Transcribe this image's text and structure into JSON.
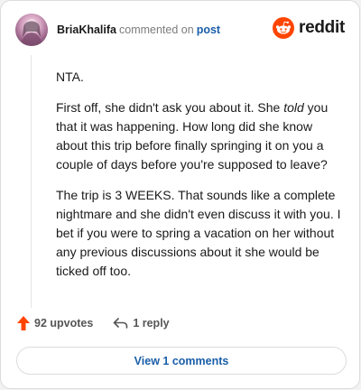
{
  "header": {
    "username": "BriaKhalifa",
    "verb": "commented on",
    "target": "post",
    "avatar_icon": "user-avatar"
  },
  "brand": {
    "name": "reddit",
    "icon": "reddit-snoo-icon",
    "color": "#ff4500"
  },
  "comment": {
    "paragraphs": [
      {
        "text": "NTA."
      },
      {
        "before": "First off, she didn't ask you about it. She ",
        "emphasis": "told",
        "after": " you that it was happening. How long did she know about this trip before finally springing it on you a couple of days before you're supposed to leave?"
      },
      {
        "text": "The trip is 3 WEEKS. That sounds like a complete nightmare and she didn't even discuss it with you. I bet if you were to spring a vacation on her without any previous discussions about it she would be ticked off too."
      }
    ]
  },
  "actions": {
    "upvotes": "92 upvotes",
    "replies": "1 reply",
    "upvote_icon": "upvote-arrow-icon",
    "reply_icon": "reply-arrow-icon",
    "upvote_color": "#ff4500"
  },
  "footer": {
    "view_comments": "View 1 comments"
  }
}
